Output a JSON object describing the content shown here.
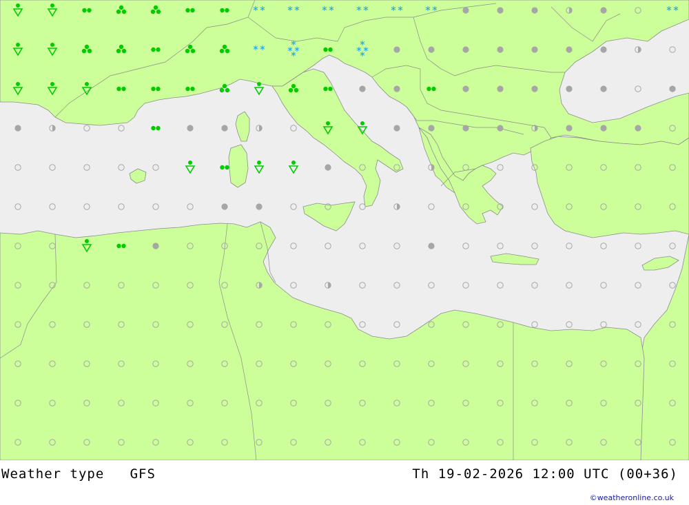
{
  "footer": {
    "title": "Weather type   GFS",
    "timestamp": "Th 19-02-2026 12:00 UTC (00+36)",
    "credit": "©weatheronline.co.uk"
  },
  "colors": {
    "land": "#ccff99",
    "sea": "#eeeeee",
    "border": "#8c8c8c",
    "rain": "#00cc00",
    "snow": "#0099ff",
    "cloud": "#a6a6a6",
    "clear_outline": "#a6a6a6"
  },
  "legend_symbols": {
    "clear": "hollow-circle",
    "partly": "half-circle",
    "cloudy": "gray-dot",
    "rain": "green-double-dot",
    "showers": "green-shower-triangle",
    "heavy": "green-cluster",
    "snow": "blue-snow-asterisks"
  },
  "grid": {
    "cols": 20,
    "rows": 12,
    "symbols": [
      "vvrhhrrSSSSSScccpcCS",
      "vvhhrhhSBrBcccccccpC",
      "vvvrrrhvhrccrcccccCc",
      "cpCCrccpCvvccccpcccC",
      "CCCCCvrvvcCCpCCCCCCC",
      "CCCCCCccCCCpCCCCCCCC",
      "CCvrcCCCCCCCcCCCCCCC",
      "CCCCCCCpCpCCCCCCCCCC",
      "CCCCCCCCCCCCCCCCCCCC",
      "CCCCCCCCCCCCCCCCCCCC",
      "CCCCCCCCCCCCCCCCCCCC",
      "CCCCCCCCCCCCCCCCCCCC"
    ]
  }
}
